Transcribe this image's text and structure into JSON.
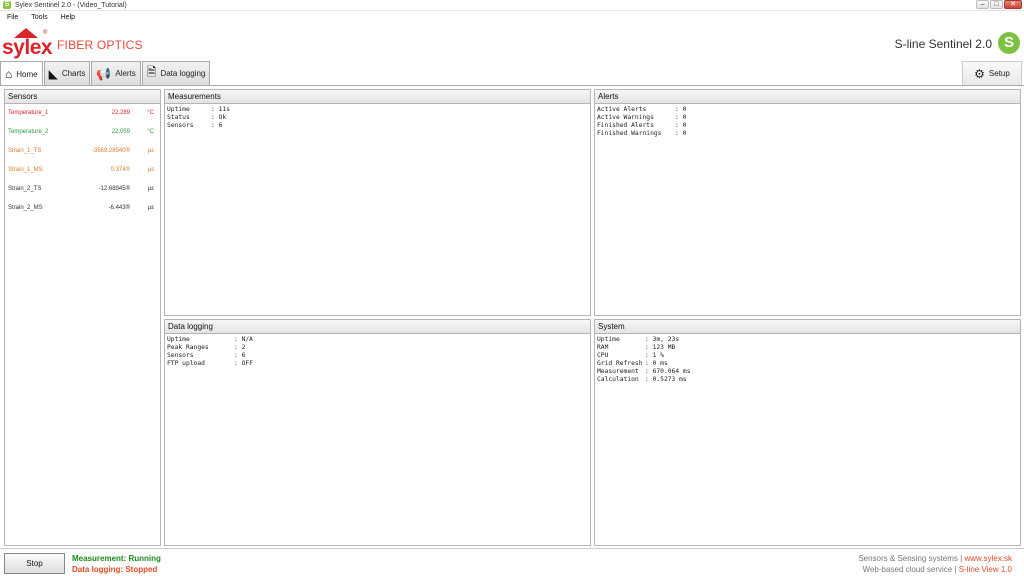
{
  "window": {
    "title": "Sylex Sentinel 2.0 - (Video_Tutorial)",
    "minimize": "–",
    "maximize": "□",
    "close": "✕"
  },
  "menu": [
    "File",
    "Tools",
    "Help"
  ],
  "brand": {
    "logo_text": "sylex",
    "registered": "®",
    "tagline": "FIBER OPTICS",
    "product": "S-line Sentinel 2.0",
    "product_logo_letter": "S"
  },
  "tabs": [
    {
      "label": "Home",
      "icon": "home-icon",
      "glyph": "⌂"
    },
    {
      "label": "Charts",
      "icon": "chart-icon",
      "glyph": "◣"
    },
    {
      "label": "Alerts",
      "icon": "megaphone-icon",
      "glyph": "📢"
    },
    {
      "label": "Data logging",
      "icon": "document-icon",
      "glyph": "🗎"
    }
  ],
  "setup": {
    "label": "Setup",
    "icon": "gear-icon",
    "glyph": "⚙"
  },
  "sensors": {
    "title": "Sensors",
    "items": [
      {
        "name": "Temperature_1",
        "value": "22.289",
        "unit": "°C",
        "color": "#d9232d"
      },
      {
        "name": "Temperature_2",
        "value": "22.059",
        "unit": "°C",
        "color": "#2e9b3c"
      },
      {
        "name": "Strain_1_TS",
        "value": "-3569.28540®",
        "unit": "µε",
        "color": "#e07b2a"
      },
      {
        "name": "Strain_1_MS",
        "value": "0.374®",
        "unit": "µε",
        "color": "#e07b2a"
      },
      {
        "name": "Strain_2_TS",
        "value": "-12.68945®",
        "unit": "µε",
        "color": "#333333"
      },
      {
        "name": "Strain_2_MS",
        "value": "-6.443®",
        "unit": "µε",
        "color": "#333333"
      }
    ]
  },
  "measurements": {
    "title": "Measurements",
    "rows": [
      {
        "k": "Uptime",
        "v": "11s"
      },
      {
        "k": "Status",
        "v": "Ok"
      },
      {
        "k": "Sensors",
        "v": "6"
      }
    ]
  },
  "alerts": {
    "title": "Alerts",
    "rows": [
      {
        "k": "Active Alerts",
        "v": "0"
      },
      {
        "k": "Active Warnings",
        "v": "0"
      },
      {
        "k": "Finished Alerts",
        "v": "0"
      },
      {
        "k": "Finished Warnings",
        "v": "0"
      }
    ]
  },
  "datalogging": {
    "title": "Data logging",
    "rows": [
      {
        "k": "Uptime",
        "v": "N/A"
      },
      {
        "k": "Peak Ranges",
        "v": "2"
      },
      {
        "k": "Sensors",
        "v": "6"
      },
      {
        "k": "FTP upload",
        "v": "OFF"
      }
    ]
  },
  "system": {
    "title": "System",
    "rows": [
      {
        "k": "Uptime",
        "v": "3m, 23s"
      },
      {
        "k": "RAM",
        "v": "123 MB"
      },
      {
        "k": "CPU",
        "v": "1 %"
      },
      {
        "k": "Grid Refresh",
        "v": "0 ms"
      },
      {
        "k": "Measurement",
        "v": "670.064 ms"
      },
      {
        "k": "Calculation",
        "v": "0.5273 ms"
      }
    ]
  },
  "footer": {
    "stop_label": "Stop",
    "measurement_status": "Measurement: Running",
    "logging_status": "Data logging:  Stopped",
    "line1_text": "Sensors & Sensing systems | ",
    "line1_link": "www.sylex.sk",
    "line2_text": "Web-based cloud service | ",
    "line2_link": "S-line View 1.0"
  }
}
